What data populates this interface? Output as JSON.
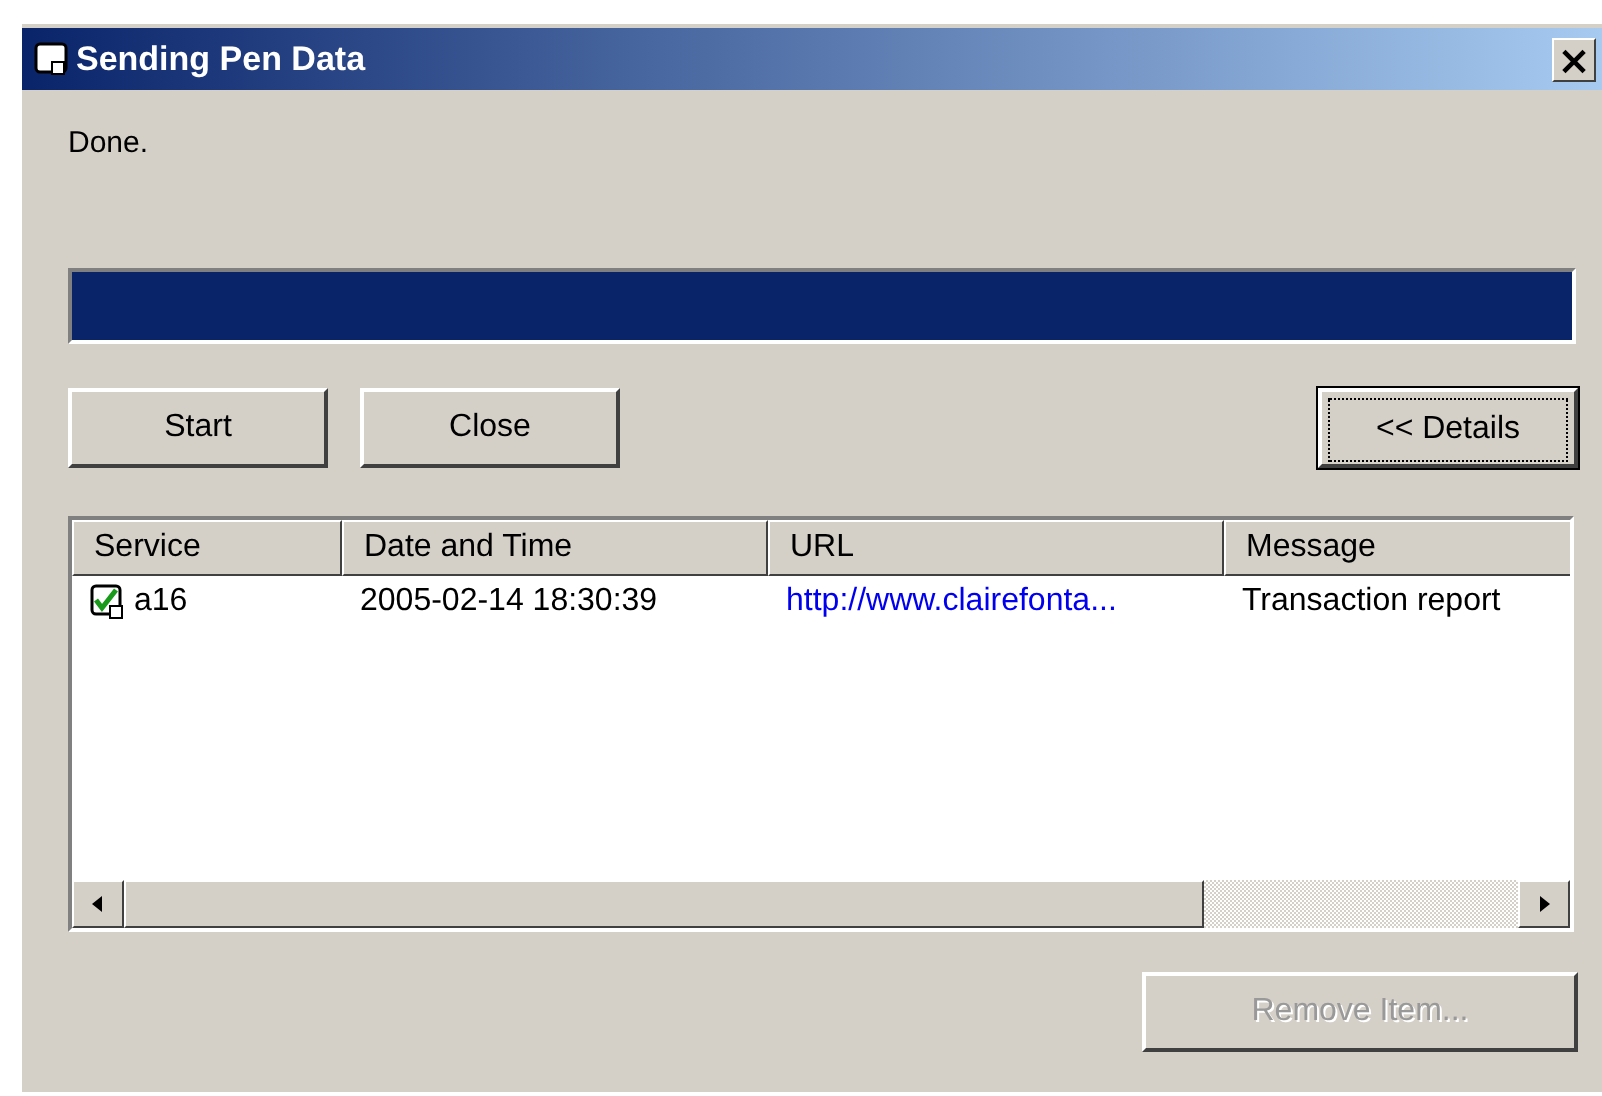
{
  "window": {
    "title": "Sending Pen Data",
    "close_label": "×"
  },
  "status": "Done.",
  "progress": {
    "level": 1
  },
  "buttons": [
    {
      "label": "Start",
      "disabled": false,
      "focused": false
    },
    {
      "label": "Close",
      "disabled": false,
      "focused": false
    }
  ],
  "details_button": {
    "label": "<< Details",
    "disabled": false,
    "focused": true
  },
  "table": {
    "columns": [
      "Service",
      "Date and Time",
      "URL",
      "Message"
    ],
    "rows": [
      {
        "checked": true,
        "cells": [
          "a16",
          "2005-02-14 18:30:39",
          "http://www.clairefonta...",
          "Transaction report"
        ]
      }
    ]
  },
  "remove_button": {
    "label": "Remove Item...",
    "disabled": true
  }
}
